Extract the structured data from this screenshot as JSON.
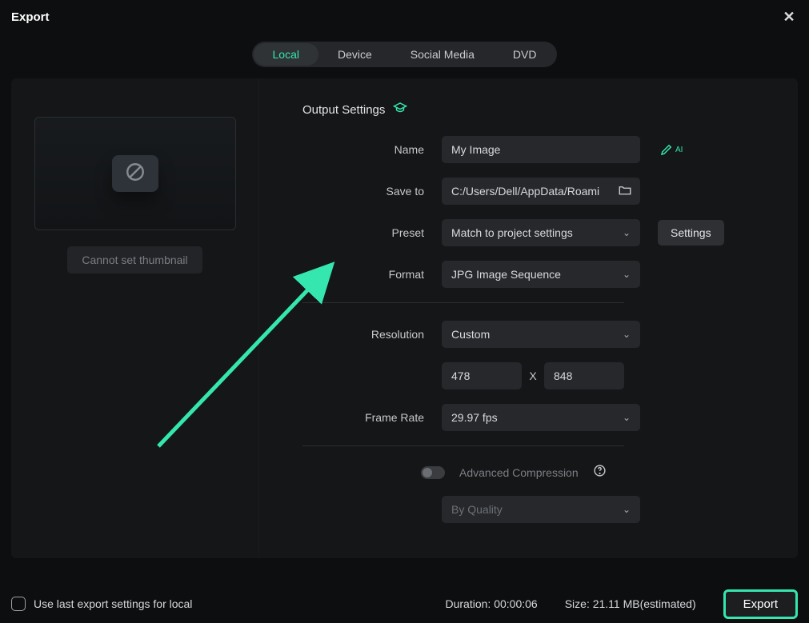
{
  "title": "Export",
  "tabs": {
    "local": "Local",
    "device": "Device",
    "social": "Social Media",
    "dvd": "DVD"
  },
  "thumb_btn": "Cannot set thumbnail",
  "section": "Output Settings",
  "labels": {
    "name": "Name",
    "saveto": "Save to",
    "preset": "Preset",
    "format": "Format",
    "resolution": "Resolution",
    "framerate": "Frame Rate",
    "advcomp": "Advanced Compression"
  },
  "values": {
    "name": "My Image",
    "saveto": "C:/Users/Dell/AppData/Roami",
    "preset": "Match to project settings",
    "format": "JPG Image Sequence",
    "resolution": "Custom",
    "width": "478",
    "height": "848",
    "framerate": "29.97 fps",
    "quality": "By Quality"
  },
  "settings_btn": "Settings",
  "ai_label": "AI",
  "res_x_label": "X",
  "bottom": {
    "checkbox_label": "Use last export settings for local",
    "duration_label": "Duration:",
    "duration": "00:00:06",
    "size_label": "Size:",
    "size": "21.11 MB",
    "size_suffix": "(estimated)",
    "export": "Export"
  }
}
